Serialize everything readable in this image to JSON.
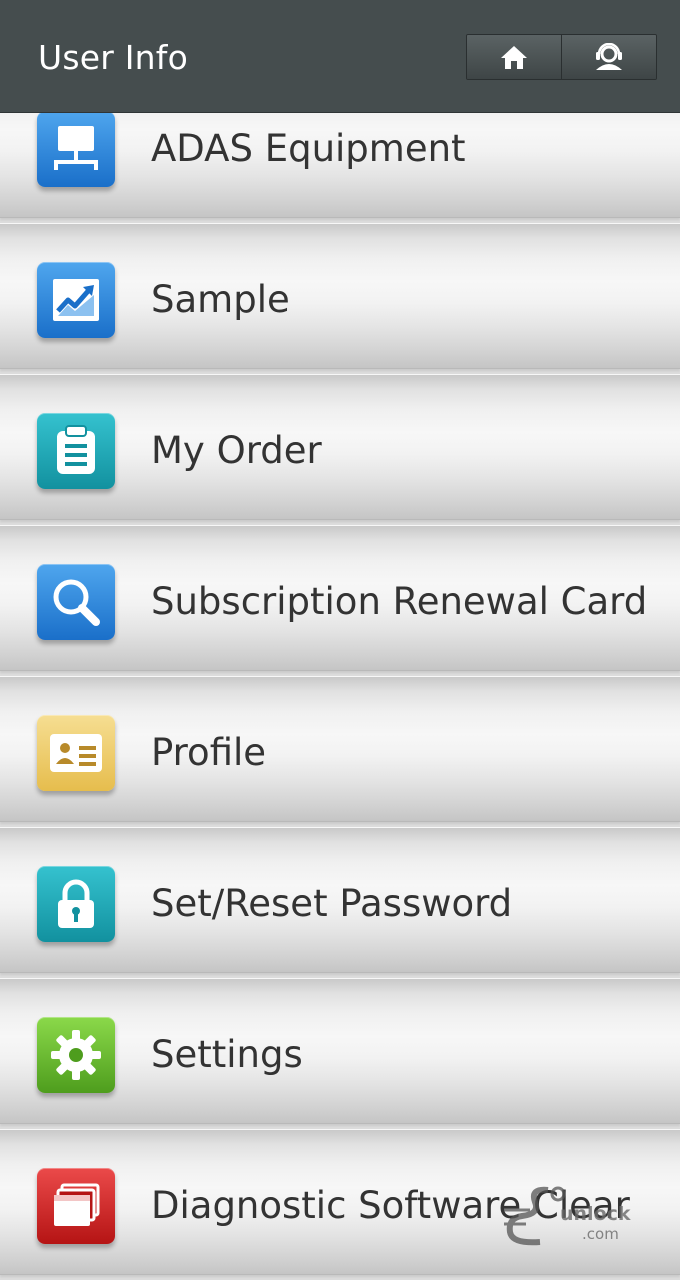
{
  "header": {
    "title": "User Info",
    "home_icon": "home-icon",
    "support_icon": "customer-service-icon"
  },
  "menu": {
    "items": [
      {
        "label": "ADAS Equipment",
        "icon": "network-equipment-icon",
        "color": "#1a6fc9"
      },
      {
        "label": "Sample",
        "icon": "chart-trend-icon",
        "color": "#1a6fc9"
      },
      {
        "label": "My Order",
        "icon": "clipboard-icon",
        "color": "#12919f"
      },
      {
        "label": "Subscription Renewal Card",
        "icon": "search-magnifier-icon",
        "color": "#1a6fc9"
      },
      {
        "label": "Profile",
        "icon": "id-card-icon",
        "color": "#e6bd4d"
      },
      {
        "label": "Set/Reset Password",
        "icon": "lock-icon",
        "color": "#12919f"
      },
      {
        "label": "Settings",
        "icon": "gear-icon",
        "color": "#4e9d1d"
      },
      {
        "label": "Diagnostic Software Clear",
        "icon": "windows-stack-icon",
        "color": "#b51414"
      }
    ]
  },
  "watermark": {
    "text_main": "unlock",
    "text_sub": ".com"
  }
}
